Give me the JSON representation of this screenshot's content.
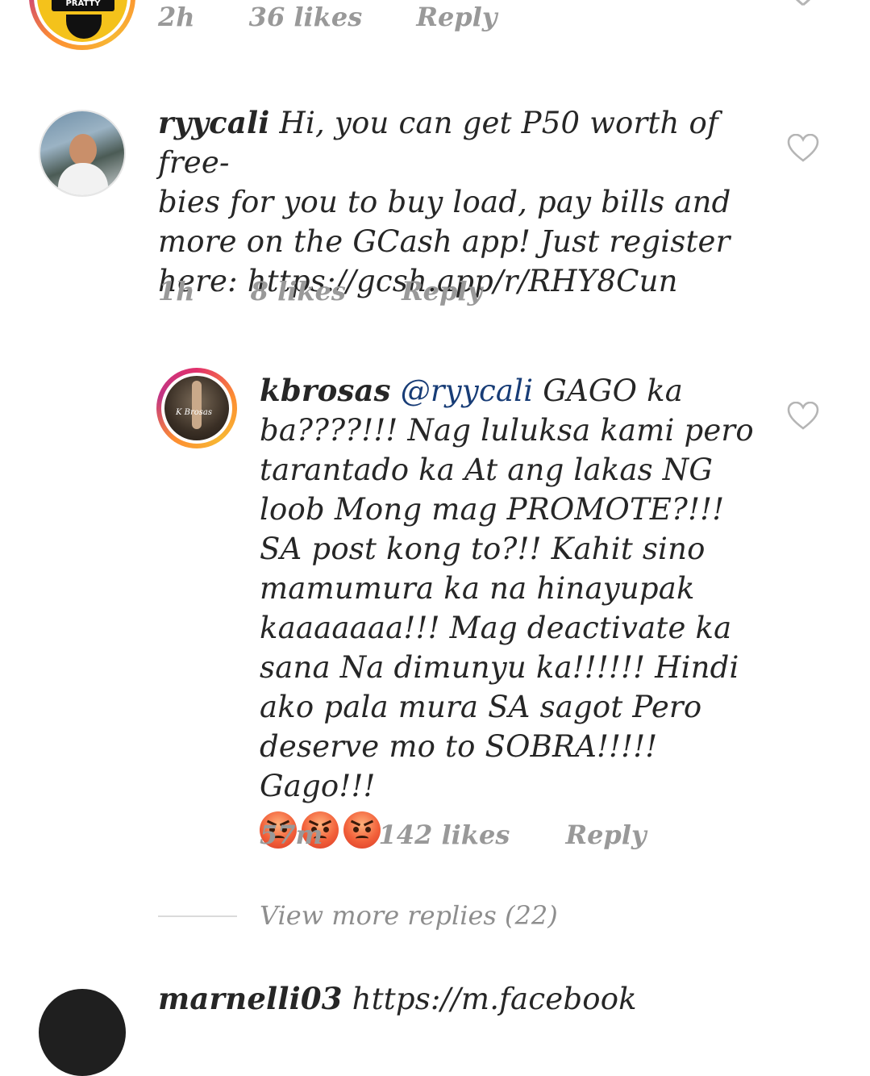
{
  "top_comment": {
    "avatar_text": "PRATTY",
    "time": "2h",
    "likes": "36 likes",
    "reply": "Reply"
  },
  "comment1": {
    "username": "ryycali",
    "lines": [
      " Hi, you can get P50 worth of free-",
      "bies for you to buy load, pay bills and",
      "more on the GCash app! Just register",
      "here: https://gcsh.app/r/RHY8Cun"
    ],
    "time": "1h",
    "likes": "8 likes",
    "reply": "Reply"
  },
  "reply1": {
    "username": "kbrosas",
    "mention": "@ryycali",
    "lines": [
      " GAGO ka",
      "ba????!!! Nag luluksa kami pero",
      "tarantado ka At ang lakas NG",
      "loob Mong mag PROMOTE?!!!",
      "SA post kong to?!! Kahit sino",
      "mamumura ka na hinayupak",
      "kaaaaaaa!!! Mag deactivate ka",
      "sana Na dimunyu ka!!!!!! Hindi",
      "ako pala mura SA sagot Pero",
      "deserve mo to SOBRA!!!!! Gago!!!"
    ],
    "avatar_text": "K Brosas",
    "emoji_icons": [
      "angry-face-icon",
      "angry-face-icon",
      "angry-face-icon"
    ],
    "time": "57m",
    "likes": "142 likes",
    "reply": "Reply"
  },
  "view_more": "View more replies (22)",
  "bottom_comment": {
    "username": "marnelli03",
    "text": " https://m.facebook"
  },
  "colors": {
    "text": "#262626",
    "meta": "#999999",
    "mention": "#173c76",
    "divider": "#dbdbdb"
  }
}
